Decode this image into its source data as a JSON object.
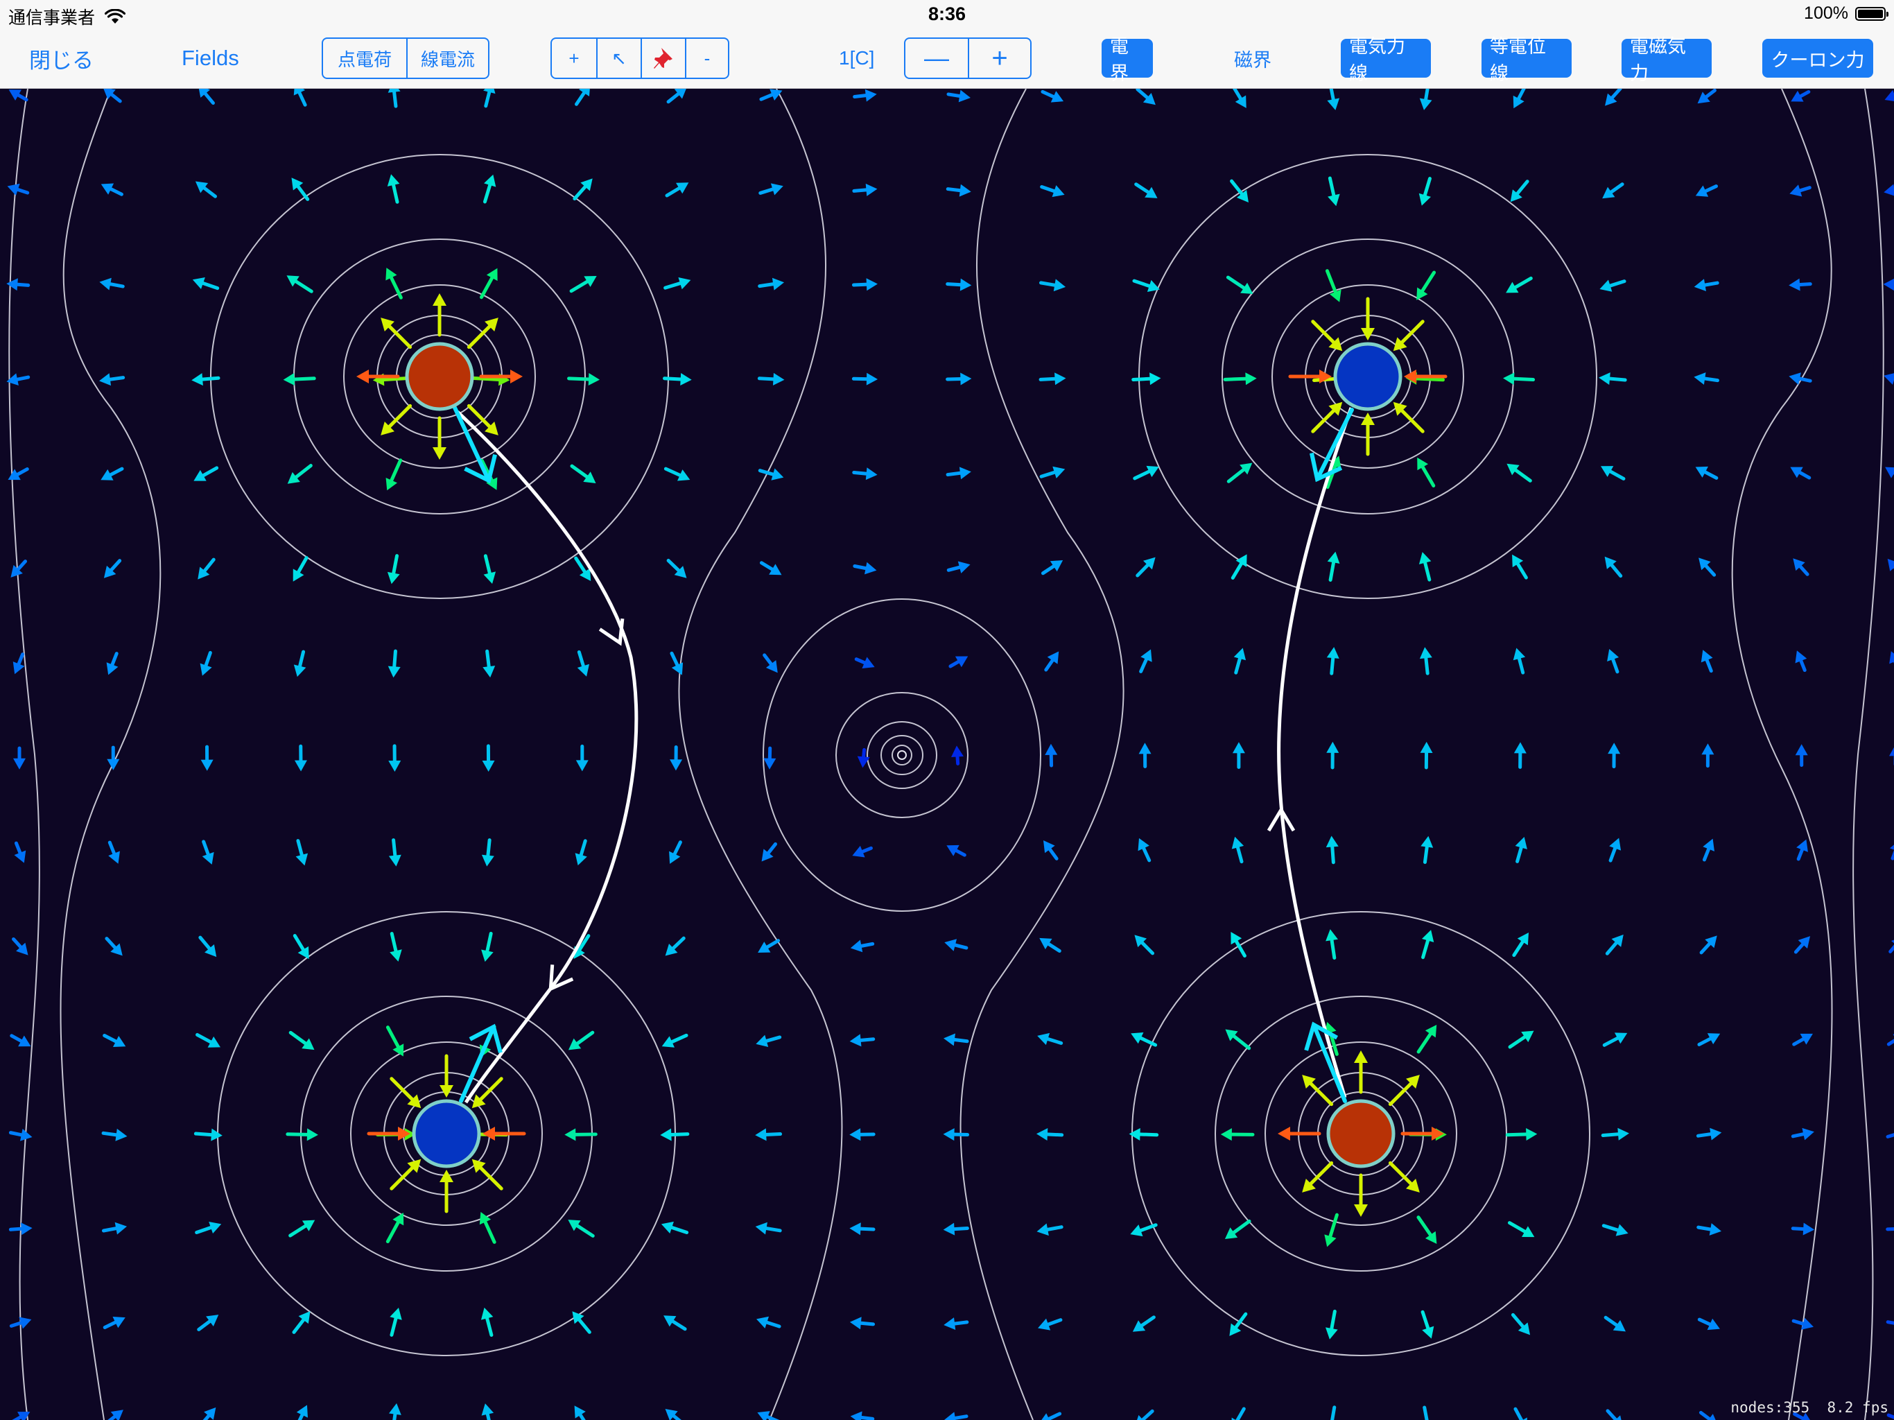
{
  "status": {
    "carrier": "通信事業者",
    "time": "8:36",
    "battery": "100%"
  },
  "toolbar": {
    "close": "閉じる",
    "fields": "Fields",
    "source_segment": [
      {
        "label": "点電荷",
        "active": true
      },
      {
        "label": "線電流",
        "active": false
      }
    ],
    "tool_segment": [
      {
        "label": "+",
        "active": true,
        "icon": "plus"
      },
      {
        "label": "↖",
        "active": false,
        "icon": "select-arrow-icon"
      },
      {
        "label": "📌",
        "active": false,
        "icon": "pin-icon"
      },
      {
        "label": "-",
        "active": false,
        "icon": "minus"
      }
    ],
    "charge_value": "1[C]",
    "stepper": {
      "decrement": "—",
      "increment": "+"
    },
    "toggles": [
      {
        "label": "電界",
        "on": true
      },
      {
        "label": "磁界",
        "on": false
      },
      {
        "label": "電気力線",
        "on": true
      },
      {
        "label": "等電位線",
        "on": true
      },
      {
        "label": "電磁気力",
        "on": true
      },
      {
        "label": "クーロン力",
        "on": true
      }
    ]
  },
  "simulation": {
    "charges": [
      {
        "sign": "positive",
        "charge_c": 1,
        "color": "#b83206"
      },
      {
        "sign": "negative",
        "charge_c": -1,
        "color": "#0535c2"
      },
      {
        "sign": "negative",
        "charge_c": -1,
        "color": "#0535c2"
      },
      {
        "sign": "positive",
        "charge_c": 1,
        "color": "#b83206"
      }
    ],
    "colors": {
      "background": "#0d0624",
      "equipotential": "#ffffff",
      "field_line": "#ffffff",
      "force": "#10e0ff",
      "accent": "#1a7cf5"
    }
  },
  "footer": {
    "nodes": "nodes:355",
    "fps": "8.2 fps"
  }
}
